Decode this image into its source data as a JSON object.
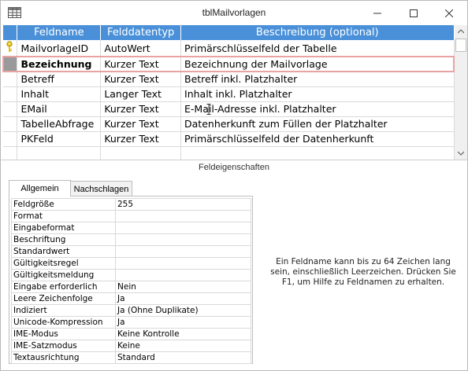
{
  "window": {
    "title": "tblMailvorlagen"
  },
  "grid": {
    "headers": [
      "Feldname",
      "Felddatentyp",
      "Beschreibung (optional)"
    ],
    "rows": [
      {
        "name": "MailvorlageID",
        "type": "AutoWert",
        "desc": "Primärschlüsselfeld der Tabelle",
        "key": true
      },
      {
        "name": "Bezeichnung",
        "type": "Kurzer Text",
        "desc": "Bezeichnung der Mailvorlage",
        "selected": true
      },
      {
        "name": "Betreff",
        "type": "Kurzer Text",
        "desc": "Betreff inkl. Platzhalter"
      },
      {
        "name": "Inhalt",
        "type": "Langer Text",
        "desc": "Inhalt inkl. Platzhalter"
      },
      {
        "name": "EMail",
        "type": "Kurzer Text",
        "desc": "E-Mail-Adresse inkl. Platzhalter"
      },
      {
        "name": "TabelleAbfrage",
        "type": "Kurzer Text",
        "desc": "Datenherkunft zum Füllen der Platzhalter"
      },
      {
        "name": "PKFeld",
        "type": "Kurzer Text",
        "desc": "Primärschlüsselfeld der Datenherkunft"
      }
    ]
  },
  "field_properties": {
    "title": "Feldeigenschaften",
    "tabs": [
      "Allgemein",
      "Nachschlagen"
    ],
    "properties": [
      {
        "label": "Feldgröße",
        "value": "255"
      },
      {
        "label": "Format",
        "value": ""
      },
      {
        "label": "Eingabeformat",
        "value": ""
      },
      {
        "label": "Beschriftung",
        "value": ""
      },
      {
        "label": "Standardwert",
        "value": ""
      },
      {
        "label": "Gültigkeitsregel",
        "value": ""
      },
      {
        "label": "Gültigkeitsmeldung",
        "value": ""
      },
      {
        "label": "Eingabe erforderlich",
        "value": "Nein"
      },
      {
        "label": "Leere Zeichenfolge",
        "value": "Ja"
      },
      {
        "label": "Indiziert",
        "value": "Ja (Ohne Duplikate)"
      },
      {
        "label": "Unicode-Kompression",
        "value": "Ja"
      },
      {
        "label": "IME-Modus",
        "value": "Keine Kontrolle"
      },
      {
        "label": "IME-Satzmodus",
        "value": "Keine"
      },
      {
        "label": "Textausrichtung",
        "value": "Standard"
      }
    ],
    "help_text": "Ein Feldname kann bis zu 64 Zeichen lang sein, einschließlich Leerzeichen. Drücken Sie F1, um Hilfe zu Feldnamen zu erhalten."
  },
  "colors": {
    "header_bg": "#4a90d9",
    "selection_border": "#e8a3a3",
    "key_icon": "#d8b400"
  }
}
